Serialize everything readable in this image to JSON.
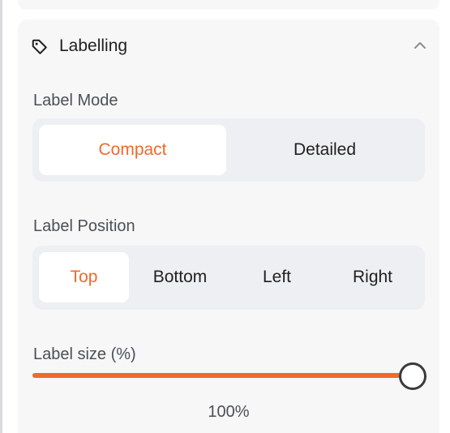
{
  "panel": {
    "title": "Labelling",
    "title_icon": "tag-icon",
    "collapse_icon": "chevron-up-icon",
    "accent_color": "#ee6a2c"
  },
  "label_mode": {
    "label": "Label Mode",
    "options": [
      "Compact",
      "Detailed"
    ],
    "selected": "Compact"
  },
  "label_position": {
    "label": "Label Position",
    "options": [
      "Top",
      "Bottom",
      "Left",
      "Right"
    ],
    "selected": "Top"
  },
  "label_size": {
    "label": "Label size (%)",
    "value": 100,
    "value_text": "100%"
  }
}
